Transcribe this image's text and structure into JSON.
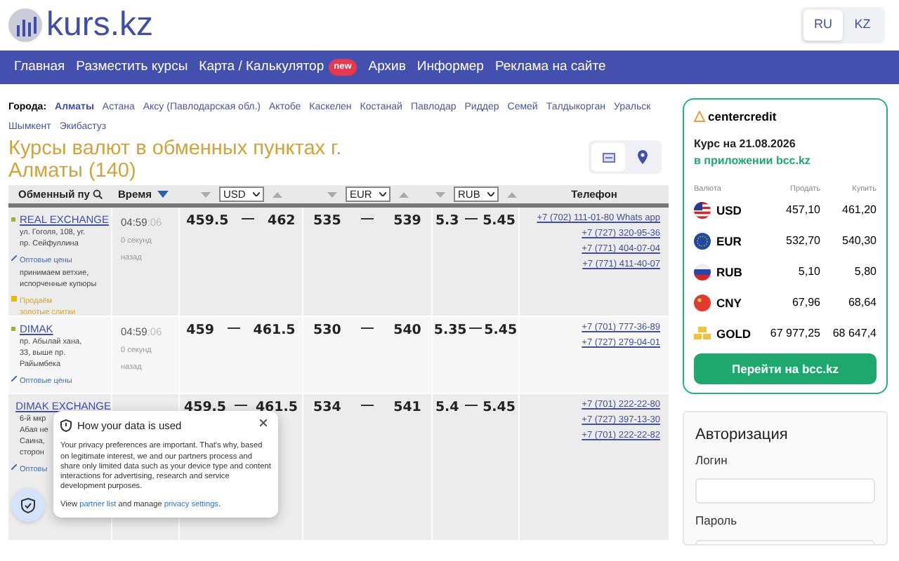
{
  "header": {
    "logo": "kurs.kz",
    "languages": [
      {
        "label": "RU",
        "selected": true
      },
      {
        "label": "KZ",
        "selected": false
      }
    ]
  },
  "nav": [
    {
      "label": "Главная"
    },
    {
      "label": "Разместить курсы"
    },
    {
      "label": "Карта / Калькулятор",
      "badge": "new"
    },
    {
      "label": "Архив"
    },
    {
      "label": "Информер"
    },
    {
      "label": "Реклама на сайте"
    }
  ],
  "cities": {
    "label": "Города:",
    "items": [
      {
        "label": "Алматы",
        "selected": true
      },
      {
        "label": "Астана",
        "selected": false
      },
      {
        "label": "Аксу (Павлодарская обл.)",
        "selected": false
      },
      {
        "label": "Актобе",
        "selected": false
      },
      {
        "label": "Каскелен",
        "selected": false
      },
      {
        "label": "Костанай",
        "selected": false
      },
      {
        "label": "Павлодар",
        "selected": false
      },
      {
        "label": "Риддер",
        "selected": false
      },
      {
        "label": "Семей",
        "selected": false
      },
      {
        "label": "Талдыкорган",
        "selected": false
      },
      {
        "label": "Уральск",
        "selected": false
      },
      {
        "label": "Шымкент",
        "selected": false
      },
      {
        "label": "Экибастуз",
        "selected": false
      }
    ]
  },
  "title": "Курсы валют в обменных пунктах г. Алматы (140)",
  "view_toggle": [
    {
      "kind": "list",
      "selected": true
    },
    {
      "kind": "map",
      "selected": false
    }
  ],
  "table": {
    "name_column": "Обменный пу",
    "time_column": "Время",
    "currencies": [
      "USD",
      "EUR",
      "RUB"
    ],
    "phone_column": "Телефон",
    "rows": [
      {
        "name": "REAL EXCHANGE",
        "address": [
          "ул. Гоголя, 108, уг.",
          "пр. Сейфуллина"
        ],
        "time": "04:59",
        "seconds": ":06",
        "ago": [
          "0 секунд",
          "назад"
        ],
        "rates": [
          [
            "459.5",
            "462"
          ],
          [
            "535",
            "539"
          ],
          [
            "5.3",
            "5.45"
          ]
        ],
        "phones": [
          "+7 (702) 111-01-80 Whats app",
          "+7 (727) 320-95-36",
          "+7 (771) 404-07-04",
          "+7 (771) 411-40-07"
        ],
        "notes": [
          {
            "kind": "wholesale",
            "text": "Оптовые цены"
          },
          {
            "kind": "text",
            "text": "принимаем ветхие, испорченные купюры"
          },
          {
            "kind": "gold",
            "text": "Продаём золотые слитки"
          }
        ]
      },
      {
        "name": "DIMAK",
        "address": [
          "пр. Абылай хана,",
          "33, выше пр.",
          "Райымбека"
        ],
        "time": "04:59",
        "seconds": ":06",
        "ago": [
          "0 секунд",
          "назад"
        ],
        "rates": [
          [
            "459",
            "461.5"
          ],
          [
            "530",
            "540"
          ],
          [
            "5.35",
            "5.45"
          ]
        ],
        "phones": [
          "+7 (701) 777-36-89",
          "+7 (727) 279-04-01"
        ],
        "notes": [
          {
            "kind": "wholesale",
            "text": "Оптовые цены"
          }
        ]
      },
      {
        "name": "DIMAK EXCHANGE",
        "address": [
          "6-й мкр",
          "Абая не",
          "Саина,",
          "сторон"
        ],
        "rates": [
          [
            "459.5",
            "461.5"
          ],
          [
            "534",
            "541"
          ],
          [
            "5.4",
            "5.45"
          ]
        ],
        "phones": [
          "+7 (701) 222-22-80",
          "+7 (727) 397-13-30",
          "+7 (701) 222-22-82"
        ],
        "notes": [
          {
            "kind": "wholesale",
            "text": "Оптовы"
          }
        ]
      }
    ]
  },
  "privacy_popup": {
    "title": "How your data is used",
    "body": "Your privacy preferences are important. That's why, based on legitimate interest, we and our partners process and share only limited data such as your device type and content interactions for advertising, research and service development purposes.",
    "footer": {
      "before": "View ",
      "partner_link": "partner list",
      "middle": " and manage ",
      "settings_link": "privacy settings",
      "after": "."
    }
  },
  "bank_card": {
    "brand": "centercredit",
    "rate_date": "Курс на 21.08.2026",
    "subtitle": "в приложении bcc.kz",
    "columns": [
      "Валюта",
      "Продать",
      "Купить"
    ],
    "rows": [
      {
        "kind": "us",
        "code": "USD",
        "sell": "457,10",
        "buy": "461,20"
      },
      {
        "kind": "eu",
        "code": "EUR",
        "sell": "532,70",
        "buy": "540,30"
      },
      {
        "kind": "ru",
        "code": "RUB",
        "sell": "5,10",
        "buy": "5,80"
      },
      {
        "kind": "cn",
        "code": "CNY",
        "sell": "67,96",
        "buy": "68,64"
      },
      {
        "kind": "gold",
        "code": "GOLD",
        "sell": "67 977,25",
        "buy": "68 647,4"
      }
    ],
    "button": "Перейти на bcc.kz"
  },
  "auth": {
    "title": "Авторизация",
    "fields": [
      {
        "label": "Логин"
      },
      {
        "label": "Пароль"
      }
    ]
  }
}
